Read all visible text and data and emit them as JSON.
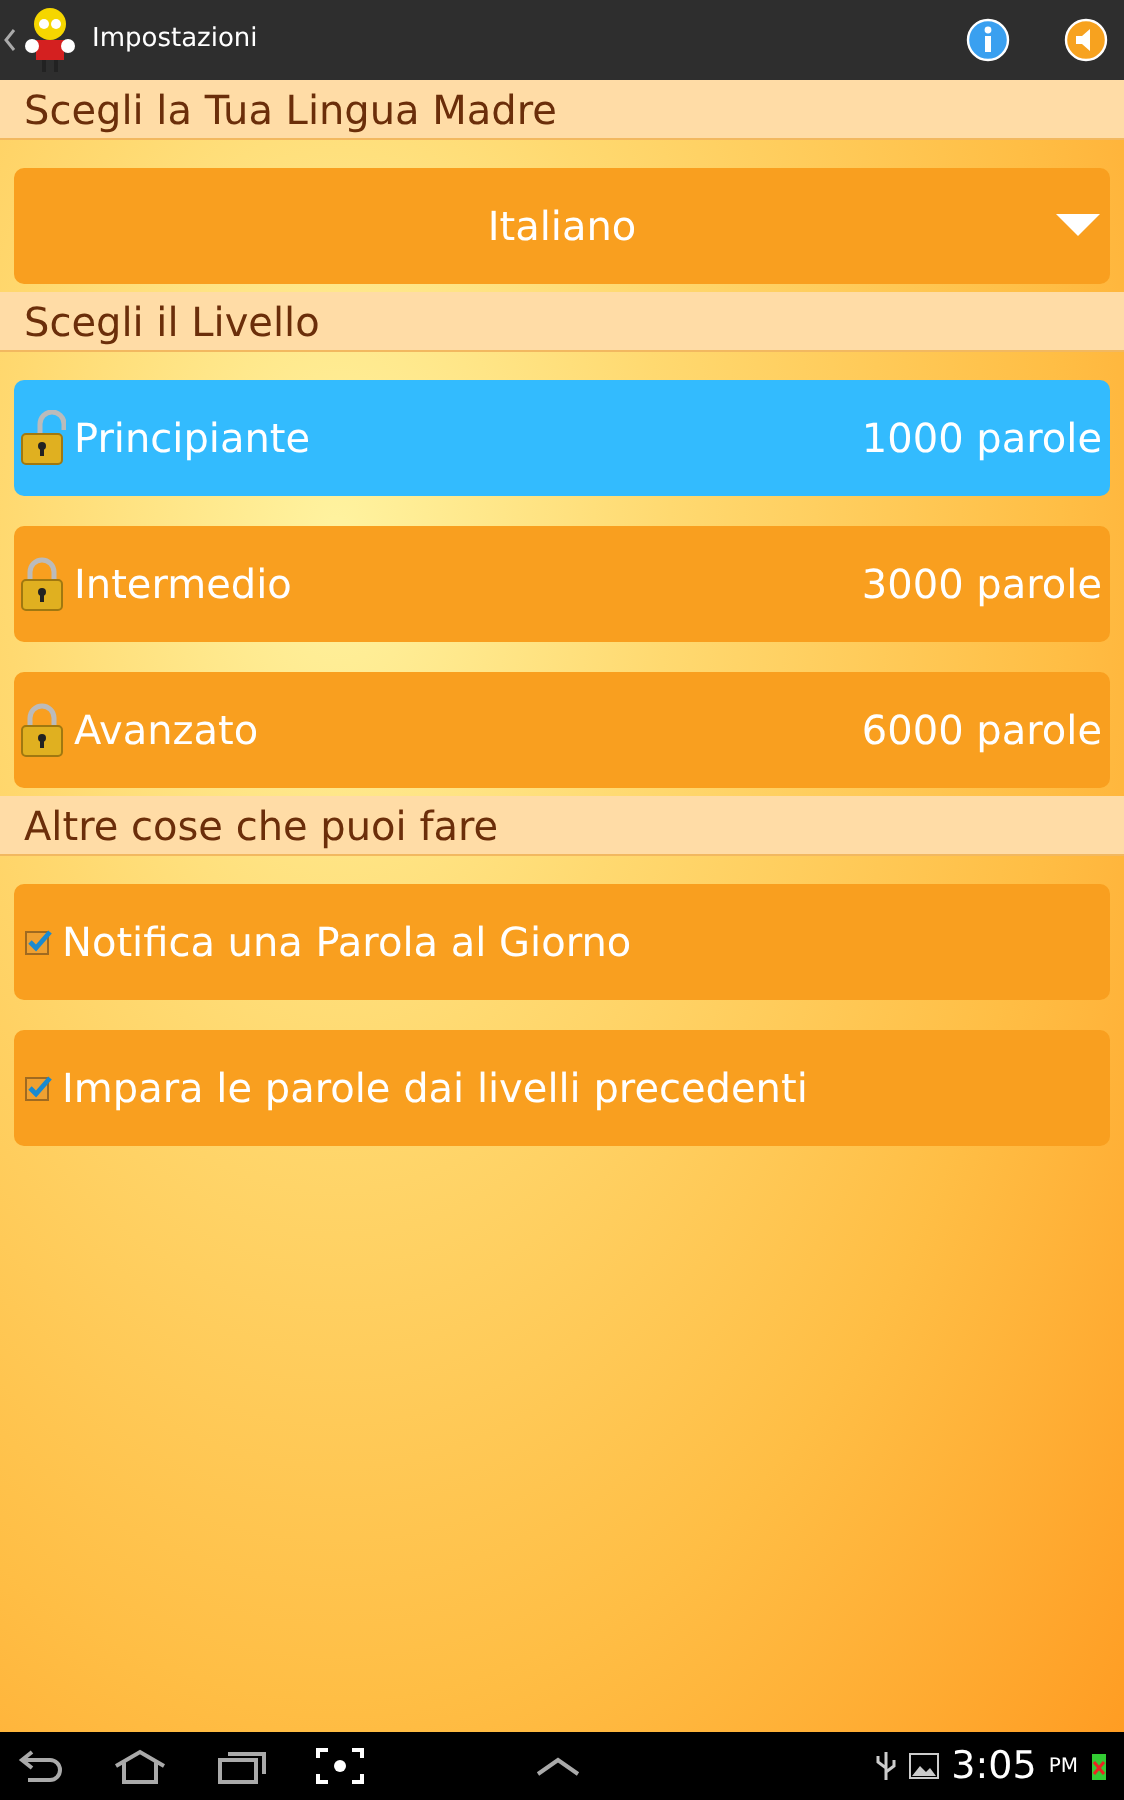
{
  "action_bar": {
    "title": "Impostazioni"
  },
  "language_section": {
    "header": "Scegli la Tua Lingua Madre",
    "dropdown_value": "Italiano"
  },
  "level_section": {
    "header": "Scegli il Livello",
    "levels": [
      {
        "name": "Principiante",
        "words": "1000 parole",
        "selected": true,
        "unlocked": true
      },
      {
        "name": "Intermedio",
        "words": "3000 parole",
        "selected": false,
        "unlocked": false
      },
      {
        "name": "Avanzato",
        "words": "6000 parole",
        "selected": false,
        "unlocked": false
      }
    ]
  },
  "options_section": {
    "header": "Altre cose che puoi fare",
    "options": [
      {
        "label": "Notifica una Parola al Giorno",
        "checked": true
      },
      {
        "label": "Impara le parole dai livelli precedenti",
        "checked": true
      }
    ]
  },
  "status_bar": {
    "time": "3:05",
    "meridiem": "PM"
  }
}
